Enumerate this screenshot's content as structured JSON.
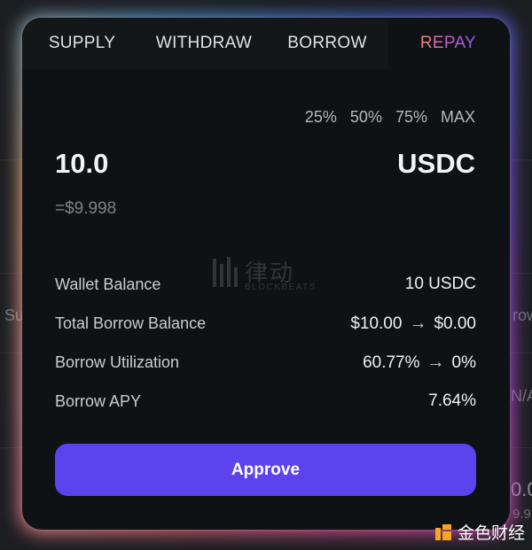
{
  "background": {
    "left_labels": [
      "Su"
    ],
    "right_labels": [
      "row",
      "N/A",
      "0.0",
      "9.9"
    ]
  },
  "tabs": [
    {
      "label": "SUPPLY"
    },
    {
      "label": "WITHDRAW"
    },
    {
      "label": "BORROW"
    },
    {
      "label": "REPAY",
      "active": true
    }
  ],
  "quick_amounts": [
    "25%",
    "50%",
    "75%",
    "MAX"
  ],
  "amount": {
    "value": "10.0",
    "token": "USDC",
    "usd_value": "=$9.998"
  },
  "watermark": {
    "cn_text": "律动",
    "en_text": "BLOCKBEATS"
  },
  "info": [
    {
      "label": "Wallet Balance",
      "value": "10 USDC"
    },
    {
      "label": "Total Borrow Balance",
      "from": "$10.00",
      "to": "$0.00"
    },
    {
      "label": "Borrow Utilization",
      "from": "60.77%",
      "to": "0%"
    },
    {
      "label": "Borrow APY",
      "value": "7.64%"
    }
  ],
  "approve_label": "Approve",
  "brand": {
    "text": "金色财经"
  },
  "colors": {
    "modal_bg": "#0f1215",
    "accent": "#5b43ee",
    "tab_bg": "#14171a",
    "muted_text": "#7d8187"
  }
}
